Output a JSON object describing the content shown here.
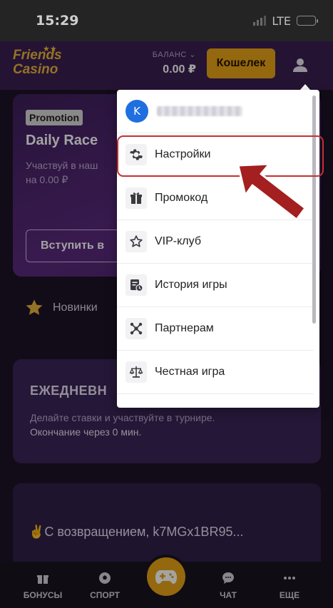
{
  "status_bar": {
    "time": "15:29",
    "network": "LTE"
  },
  "header": {
    "logo_line1": "Friends",
    "logo_line2": "Casino",
    "balance_label": "БАЛАНС",
    "balance_value": "0.00 ₽",
    "wallet_button": "Кошелек"
  },
  "promo": {
    "badge": "Promotion",
    "title": "Daily Race",
    "description": "Участвуй в наш",
    "description2": "на 0.00 ₽",
    "join_button": "Вступить в"
  },
  "newbies_label": "Новинки",
  "daily": {
    "title": "ЕЖЕДНЕВН",
    "desc_line1": "Делайте ставки и участвуйте в турнире.",
    "desc_line2": "Окончание через 0 мин."
  },
  "welcome": {
    "text": "✌️С возвращением, k7MGx1BR95..."
  },
  "dropdown": {
    "avatar_letter": "K",
    "items": [
      {
        "label": "Настройки",
        "icon": "gear-icon"
      },
      {
        "label": "Промокод",
        "icon": "gift-icon"
      },
      {
        "label": "VIP-клуб",
        "icon": "star-icon"
      },
      {
        "label": "История игры",
        "icon": "history-icon"
      },
      {
        "label": "Партнерам",
        "icon": "network-icon"
      },
      {
        "label": "Честная игра",
        "icon": "scales-icon"
      }
    ]
  },
  "bottom_nav": {
    "bonuses": "БОНУСЫ",
    "sport": "СПОРТ",
    "chat": "ЧАТ",
    "more": "ЕЩЕ"
  },
  "colors": {
    "accent": "#e8a317",
    "header_bg": "#3a1e52",
    "highlight": "#c23232",
    "avatar": "#1f6fe0"
  }
}
